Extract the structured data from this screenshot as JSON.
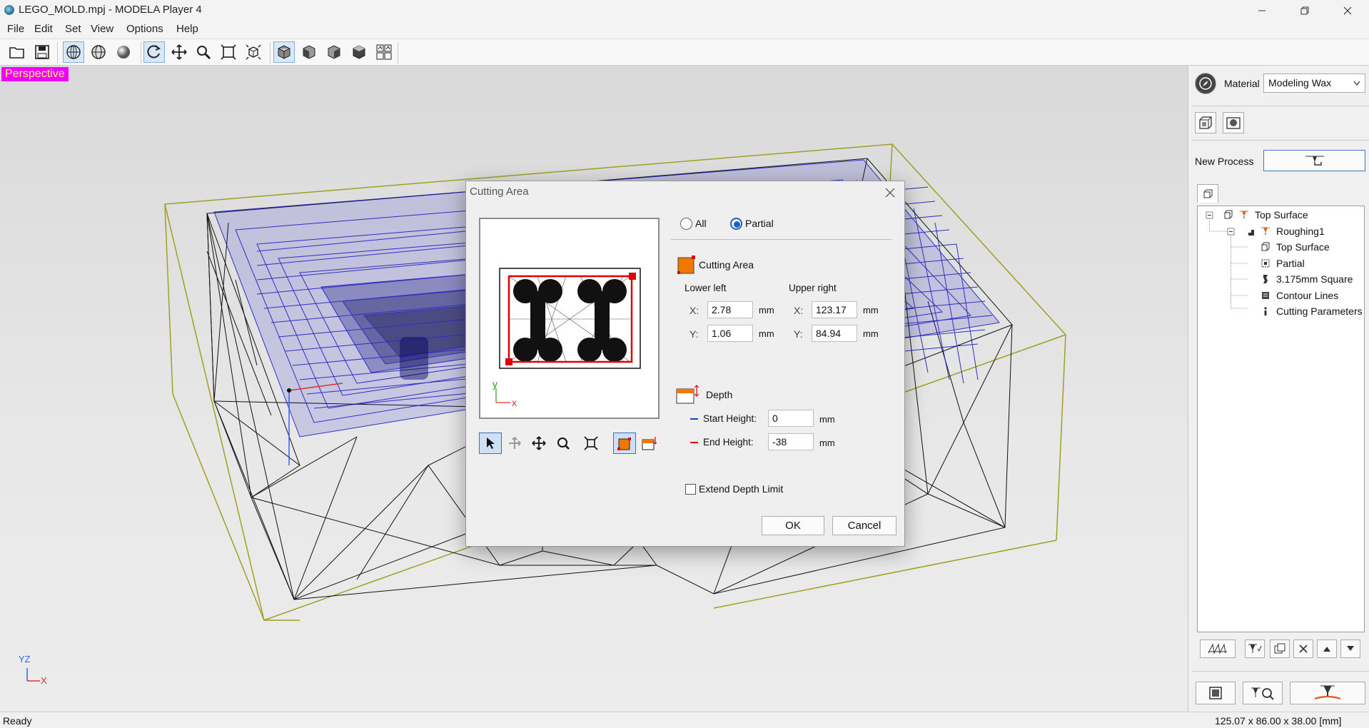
{
  "window": {
    "title": "LEGO_MOLD.mpj - MODELA Player 4"
  },
  "menu": [
    "File",
    "Edit",
    "Set",
    "View",
    "Options",
    "Help"
  ],
  "toolbar": {
    "buttons": [
      "open-file-icon",
      "save-icon",
      "wireframe-view-icon",
      "mesh-view-icon",
      "solid-view-icon",
      "rotate-icon",
      "pan-icon",
      "zoom-icon",
      "zoom-fit-icon",
      "zoom-window-icon",
      "view-perspective-icon",
      "view-front-icon",
      "view-side-icon",
      "view-back-icon",
      "view-multi-icon"
    ]
  },
  "viewport": {
    "mode_label": "Perspective",
    "axes": {
      "y": "YZ",
      "x": "X"
    }
  },
  "dialog": {
    "title": "Cutting Area",
    "preview_axes": {
      "y": "y",
      "x": "x"
    },
    "radio_all": "All",
    "radio_partial": "Partial",
    "selected": "Partial",
    "cutting_area_label": "Cutting Area",
    "lower_left_label": "Lower left",
    "upper_right_label": "Upper right",
    "x_label": "X:",
    "y_label": "Y:",
    "unit": "mm",
    "lower_left": {
      "x": "2.78",
      "y": "1.06"
    },
    "upper_right": {
      "x": "123.17",
      "y": "84.94"
    },
    "depth_label": "Depth",
    "start_height_label": "Start Height:",
    "start_height": "0",
    "end_height_label": "End Height:",
    "end_height": "-38",
    "extend_depth_label": "Extend Depth Limit",
    "extend_depth_checked": false,
    "ok": "OK",
    "cancel": "Cancel"
  },
  "right_panel": {
    "material_label": "Material",
    "material_value": "Modeling Wax",
    "new_process_label": "New Process",
    "tree": [
      {
        "label": "Top Surface",
        "icon": "model-icon",
        "level": 0
      },
      {
        "label": "Roughing1",
        "icon": "roughing-icon",
        "level": 1
      },
      {
        "label": "Top Surface",
        "icon": "model-icon",
        "level": 2
      },
      {
        "label": "Partial",
        "icon": "partial-area-icon",
        "level": 2
      },
      {
        "label": "3.175mm Square",
        "icon": "square-tool-icon",
        "level": 2
      },
      {
        "label": "Contour Lines",
        "icon": "contour-icon",
        "level": 2
      },
      {
        "label": "Cutting Parameters",
        "icon": "info-icon",
        "level": 2
      }
    ]
  },
  "status": {
    "left": "Ready",
    "right": "125.07 x 86.00 x 38.00 [mm]"
  },
  "colors": {
    "perspective_badge": "#f000ff",
    "perspective_text": "#ffff66",
    "mesh_blue": "#1010c0",
    "bounding_box": "#a0a020",
    "cutting_area_orange": "#f07800"
  }
}
